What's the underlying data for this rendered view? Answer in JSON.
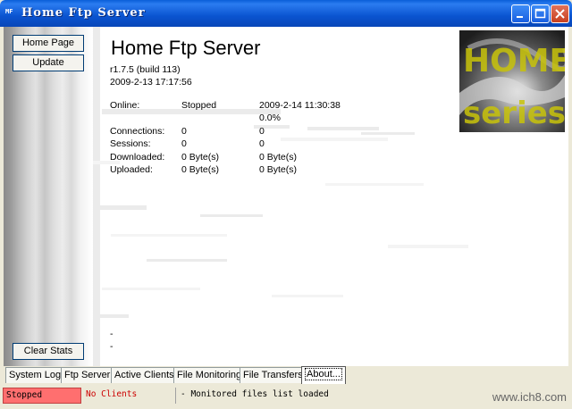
{
  "window": {
    "title": "Home Ftp Server",
    "app_icon": "MF"
  },
  "sidebar": {
    "home_label": "Home Page",
    "update_label": "Update",
    "clear_label": "Clear Stats"
  },
  "header": {
    "title": "Home Ftp Server",
    "version": "r1.7.5 (build 113)",
    "build_date": "2009-2-13 17:17:56"
  },
  "logo": {
    "line1": "HOME",
    "line2": "series"
  },
  "stats": {
    "online": {
      "label": "Online:",
      "status": "Stopped",
      "time": "2009-2-14 11:30:38",
      "percent": "0.0%"
    },
    "connections": {
      "label": "Connections:",
      "v1": "0",
      "v2": "0"
    },
    "sessions": {
      "label": "Sessions:",
      "v1": "0",
      "v2": "0"
    },
    "downloaded": {
      "label": "Downloaded:",
      "v1": "0 Byte(s)",
      "v2": "0 Byte(s)"
    },
    "uploaded": {
      "label": "Uploaded:",
      "v1": "0 Byte(s)",
      "v2": "0 Byte(s)"
    }
  },
  "footer_dashes": [
    "-",
    "-"
  ],
  "tabs": [
    "System Log",
    "Ftp Server",
    "Active Clients",
    "File Monitoring",
    "File Transfers",
    "About..."
  ],
  "statusbar": {
    "state": "Stopped",
    "clients": "No Clients",
    "message": "- Monitored files list loaded"
  },
  "watermark": "www.ich8.com",
  "colors": {
    "title_bar": "#0a54d0",
    "status_stopped_bg": "#ff6f6f",
    "status_clients_text": "#cc0000"
  }
}
